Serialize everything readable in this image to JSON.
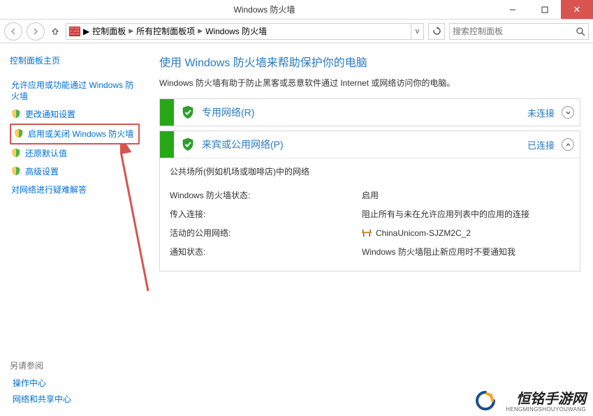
{
  "titlebar": {
    "title": "Windows 防火墙"
  },
  "breadcrumb": {
    "seg1": "控制面板",
    "seg2": "所有控制面板项",
    "seg3": "Windows 防火墙"
  },
  "search": {
    "placeholder": "搜索控制面板"
  },
  "sidebar": {
    "home": "控制面板主页",
    "items": [
      {
        "label": "允许应用或功能通过 Windows 防火墙"
      },
      {
        "label": "更改通知设置"
      },
      {
        "label": "启用或关闭 Windows 防火墙"
      },
      {
        "label": "还原默认值"
      },
      {
        "label": "高级设置"
      },
      {
        "label": "对网络进行疑难解答"
      }
    ],
    "see_also_label": "另请参阅",
    "see_also": [
      {
        "label": "操作中心"
      },
      {
        "label": "网络和共享中心"
      }
    ]
  },
  "main": {
    "title": "使用 Windows 防火墙来帮助保护你的电脑",
    "desc": "Windows 防火墙有助于防止黑客或恶意软件通过 Internet 或网络访问你的电脑。",
    "sections": [
      {
        "name": "专用网络(R)",
        "status": "未连接",
        "expanded": false
      },
      {
        "name": "来宾或公用网络(P)",
        "status": "已连接",
        "expanded": true,
        "subtitle": "公共场所(例如机场或咖啡店)中的网络",
        "rows": [
          {
            "k": "Windows 防火墙状态:",
            "v": "启用"
          },
          {
            "k": "传入连接:",
            "v": "阻止所有与未在允许应用列表中的应用的连接"
          },
          {
            "k": "活动的公用网络:",
            "v": "ChinaUnicom-SJZM2C_2",
            "icon": "net"
          },
          {
            "k": "通知状态:",
            "v": "Windows 防火墙阻止新应用时不要通知我"
          }
        ]
      }
    ]
  },
  "watermark": {
    "big": "恒铭手游网",
    "small": "HENGMINGSHOUYOUWANG"
  }
}
